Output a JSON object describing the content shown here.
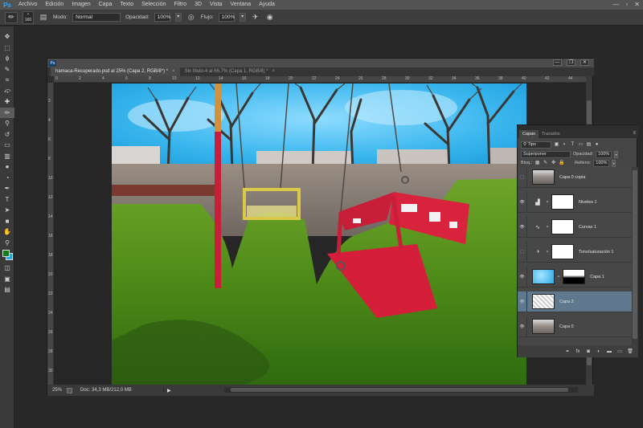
{
  "app": {
    "logo": "Ps",
    "menu": [
      "Archivo",
      "Edición",
      "Imagen",
      "Capa",
      "Texto",
      "Selección",
      "Filtro",
      "3D",
      "Vista",
      "Ventana",
      "Ayuda"
    ],
    "window_controls": {
      "minimize": "—",
      "maximize": "▫",
      "close": "✕"
    }
  },
  "options": {
    "brush_size": "160",
    "mode_label": "Modo:",
    "mode_value": "Normal",
    "opacity_label": "Opacidad:",
    "opacity_value": "100%",
    "flow_label": "Flujo:",
    "flow_value": "100%"
  },
  "toolbox": {
    "tools": [
      {
        "name": "move-tool",
        "glyph": "✥"
      },
      {
        "name": "marquee-tool",
        "glyph": "⬚"
      },
      {
        "name": "lasso-tool",
        "glyph": "ϕ"
      },
      {
        "name": "quick-select-tool",
        "glyph": "✎"
      },
      {
        "name": "crop-tool",
        "glyph": "⌗"
      },
      {
        "name": "eyedropper-tool",
        "glyph": "⤽"
      },
      {
        "name": "healing-brush-tool",
        "glyph": "✚"
      },
      {
        "name": "brush-tool",
        "glyph": "✏"
      },
      {
        "name": "clone-stamp-tool",
        "glyph": "⚲"
      },
      {
        "name": "history-brush-tool",
        "glyph": "↺"
      },
      {
        "name": "eraser-tool",
        "glyph": "▭"
      },
      {
        "name": "gradient-tool",
        "glyph": "▥"
      },
      {
        "name": "blur-tool",
        "glyph": "●"
      },
      {
        "name": "dodge-tool",
        "glyph": "◔"
      },
      {
        "name": "pen-tool",
        "glyph": "✒"
      },
      {
        "name": "type-tool",
        "glyph": "T"
      },
      {
        "name": "path-select-tool",
        "glyph": "➤"
      },
      {
        "name": "shape-tool",
        "glyph": "■"
      },
      {
        "name": "hand-tool",
        "glyph": "✋"
      },
      {
        "name": "zoom-tool",
        "glyph": "⚲"
      }
    ],
    "extra": [
      "◫",
      "▣",
      "▤"
    ],
    "fg_color": "#1a7a1a",
    "bg_color": "#29a6e0"
  },
  "document": {
    "tabs": [
      {
        "label": "hamaca-Recuperado.psd al 25% (Capa 2, RGB/8*) *",
        "close": "×"
      },
      {
        "label": "Sin título-4 al 66,7% (Capa 1, RGB/8) *",
        "close": "×"
      }
    ],
    "ruler_numbers": [
      "0",
      "2",
      "4",
      "6",
      "8",
      "10",
      "12",
      "14",
      "16",
      "18",
      "20",
      "22",
      "24",
      "26",
      "28",
      "30",
      "32",
      "34",
      "36",
      "38",
      "40",
      "42",
      "44"
    ],
    "ruler_left_numbers": [
      "2",
      "4",
      "6",
      "8",
      "10",
      "12",
      "14",
      "16",
      "18",
      "20",
      "22",
      "24",
      "26",
      "28",
      "30"
    ],
    "zoom": "25%",
    "status": "Doc: 34,3 MB/212,0 MB",
    "status_arrow": "▶",
    "controls": {
      "minimize": "—",
      "restore": "❐",
      "close": "✕"
    }
  },
  "layers_panel": {
    "tabs": [
      "Capas",
      "Trazados"
    ],
    "menu_glyph": "≡",
    "filter_label": "Tipo",
    "blend_mode": "Superponer",
    "opacity_label": "Opacidad:",
    "opacity_value": "100%",
    "lock_label": "Bloq.:",
    "fill_label": "Relleno:",
    "fill_value": "100%",
    "layers": [
      {
        "name": "Capa 0 copia",
        "kind": "photo",
        "visible": false,
        "selected": false
      },
      {
        "name": "Niveles 1",
        "kind": "levels",
        "visible": true,
        "selected": false
      },
      {
        "name": "Curvas 1",
        "kind": "curves",
        "visible": true,
        "selected": false
      },
      {
        "name": "Tono/saturación 1",
        "kind": "hue",
        "visible": false,
        "selected": false
      },
      {
        "name": "Capa 1",
        "kind": "sky",
        "visible": true,
        "selected": false
      },
      {
        "name": "Capa 2",
        "kind": "grass",
        "visible": true,
        "selected": true
      },
      {
        "name": "Capa 0",
        "kind": "photo",
        "visible": true,
        "selected": false
      }
    ],
    "footer": [
      "⚭",
      "fx",
      "◙",
      "◐",
      "▬",
      "▭",
      "🗑"
    ]
  }
}
